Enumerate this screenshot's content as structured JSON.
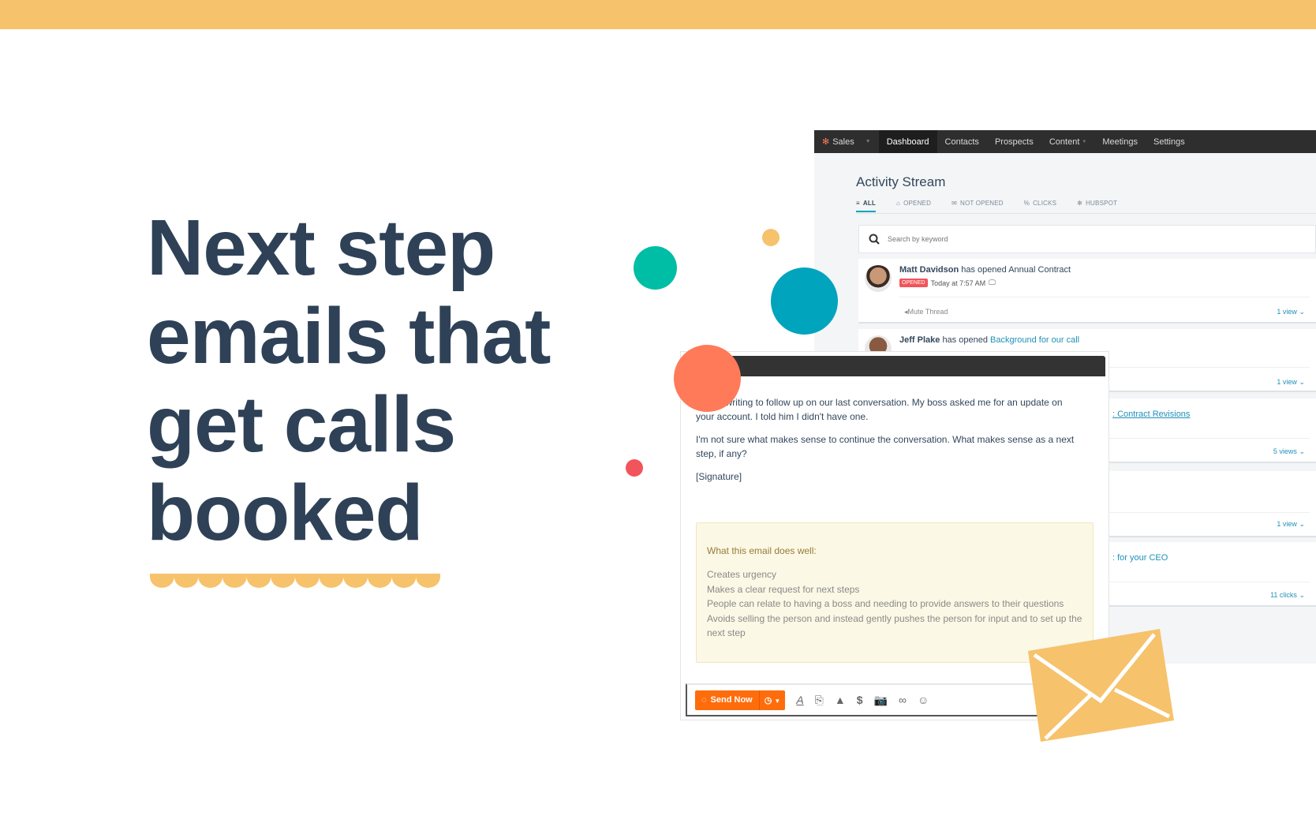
{
  "headline": {
    "lines": [
      "Next step",
      "emails that",
      "get calls",
      "booked"
    ]
  },
  "colors": {
    "top_bar": "#F6C26B",
    "headline": "#2E4157",
    "teal": "#00BDA5",
    "blue": "#00A4BD",
    "orange": "#FF7A59",
    "red": "#F2545B",
    "gold": "#F6C26B",
    "accent_link": "#1F91B8",
    "send_button": "#FF6C0C"
  },
  "nav": {
    "brand": "Sales",
    "items": [
      "Dashboard",
      "Contacts",
      "Prospects",
      "Content",
      "Meetings",
      "Settings"
    ],
    "active": "Dashboard"
  },
  "activity": {
    "title": "Activity Stream",
    "filters": [
      {
        "icon": "list-icon",
        "label": "ALL"
      },
      {
        "icon": "envelope-open-icon",
        "label": "OPENED"
      },
      {
        "icon": "envelope-icon",
        "label": "NOT OPENED"
      },
      {
        "icon": "link-icon",
        "label": "CLICKS"
      },
      {
        "icon": "hubspot-icon",
        "label": "HUBSPOT"
      }
    ],
    "search_placeholder": "Search by keyword",
    "cards": [
      {
        "name": "Matt Davidson",
        "action": "has opened",
        "object": "Annual Contract",
        "badge": "OPENED",
        "time": "Today at 7:57 AM",
        "footer_left": "Mute Thread",
        "footer_right": "1 view"
      },
      {
        "name": "Jeff Plake",
        "action": "has opened",
        "object": "Background for our call",
        "footer_right": "1 view"
      },
      {
        "object": ": Contract Revisions",
        "footer_right": "5 views"
      },
      {
        "footer_right": "1 view"
      },
      {
        "object": ": for your CEO",
        "footer_right": "11 clicks"
      }
    ]
  },
  "email": {
    "paragraphs": [
      "…, I'm writing to follow up on our last conversation. My boss asked me for an update on your account. I told him I didn't have one.",
      "I'm not sure what makes sense to continue the conversation. What makes sense as a next step, if any?",
      "[Signature]"
    ],
    "tips_title": "What this email does well:",
    "tips": [
      "Creates urgency",
      "Makes a clear request for next steps",
      "People can relate to having a boss and needing to provide answers to their questions",
      "Avoids selling the person and instead gently pushes the person for input and to set up the next step"
    ],
    "send_label": "Send Now"
  }
}
